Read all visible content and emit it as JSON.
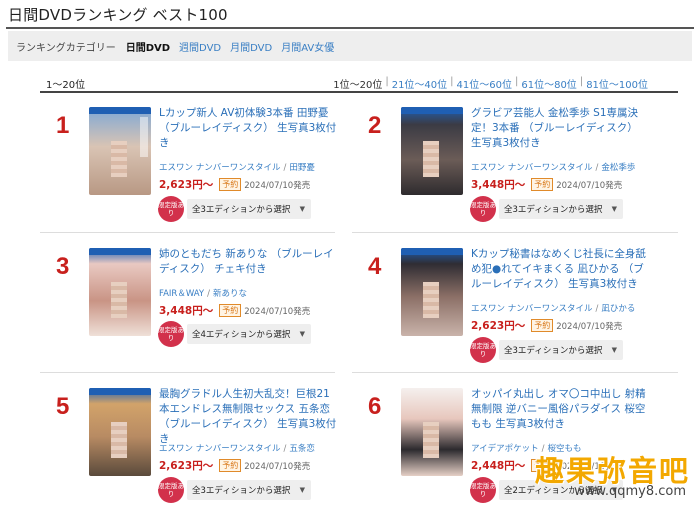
{
  "page": {
    "title": "日間DVDランキング ベスト100"
  },
  "categories": {
    "label": "ランキングカテゴリー",
    "items": [
      "日間DVD",
      "週間DVD",
      "月間DVD",
      "月間AV女優"
    ]
  },
  "pager": {
    "current_range": "1～20位",
    "links": [
      "1位～20位",
      "21位～40位",
      "41位～60位",
      "61位～80位",
      "81位～100位"
    ]
  },
  "items": [
    {
      "rank": "1",
      "title": "Lカップ新人 AV初体験3本番 田野憂 （ブルーレイディスク） 生写真3枚付き",
      "maker": "エスワン ナンバーワンスタイル",
      "actress": "田野憂",
      "price": "2,623円",
      "price_suffix": "～",
      "reserve": "予約",
      "release": "2024/07/10発売",
      "limited": "限定版あり",
      "edition": "全3エディションから選択"
    },
    {
      "rank": "2",
      "title": "グラビア芸能人 金松季歩 S1専属決定！3本番 （ブルーレイディスク） 生写真3枚付き",
      "maker": "エスワン ナンバーワンスタイル",
      "actress": "金松季歩",
      "price": "3,448円",
      "price_suffix": "～",
      "reserve": "予約",
      "release": "2024/07/10発売",
      "limited": "限定版あり",
      "edition": "全3エディションから選択"
    },
    {
      "rank": "3",
      "title": "姉のともだち 新ありな （ブルーレイディスク） チェキ付き",
      "maker": "FAIR＆WAY",
      "actress": "新ありな",
      "price": "3,448円",
      "price_suffix": "～",
      "reserve": "予約",
      "release": "2024/07/10発売",
      "limited": "限定版あり",
      "edition": "全4エディションから選択"
    },
    {
      "rank": "4",
      "title": "Kカップ秘書はなめくじ社長に全身舐め犯●れてイキまくる 凪ひかる （ブルーレイディスク） 生写真3枚付き",
      "maker": "エスワン ナンバーワンスタイル",
      "actress": "凪ひかる",
      "price": "2,623円",
      "price_suffix": "～",
      "reserve": "予約",
      "release": "2024/07/10発売",
      "limited": "限定版あり",
      "edition": "全3エディションから選択"
    },
    {
      "rank": "5",
      "title": "最胸グラドル人生初大乱交！巨根21本エンドレス無制限セックス 五条恋 （ブルーレイディスク） 生写真3枚付き",
      "maker": "エスワン ナンバーワンスタイル",
      "actress": "五条恋",
      "price": "2,623円",
      "price_suffix": "～",
      "reserve": "予約",
      "release": "2024/07/10発売",
      "limited": "限定版あり",
      "edition": "全3エディションから選択"
    },
    {
      "rank": "6",
      "title": "オッパイ丸出し オマ〇コ中出し 射精無制限 逆バニー風俗パラダイス 桜空もも 生写真3枚付き",
      "maker": "アイデアポケット",
      "actress": "桜空もも",
      "price": "2,448円",
      "price_suffix": "～",
      "reserve": "予約",
      "release": "2024/07/10発売",
      "limited": "限定版あり",
      "edition": "全2エディションから選択"
    }
  ],
  "watermark": {
    "brand": "趣果弥音吧",
    "url": "www.qqmy8.com"
  },
  "colors": {
    "accent_link": "#2a6fb8",
    "rank_red": "#c8201d",
    "limited_badge": "#d2314b",
    "reserve_orange": "#d87718"
  }
}
